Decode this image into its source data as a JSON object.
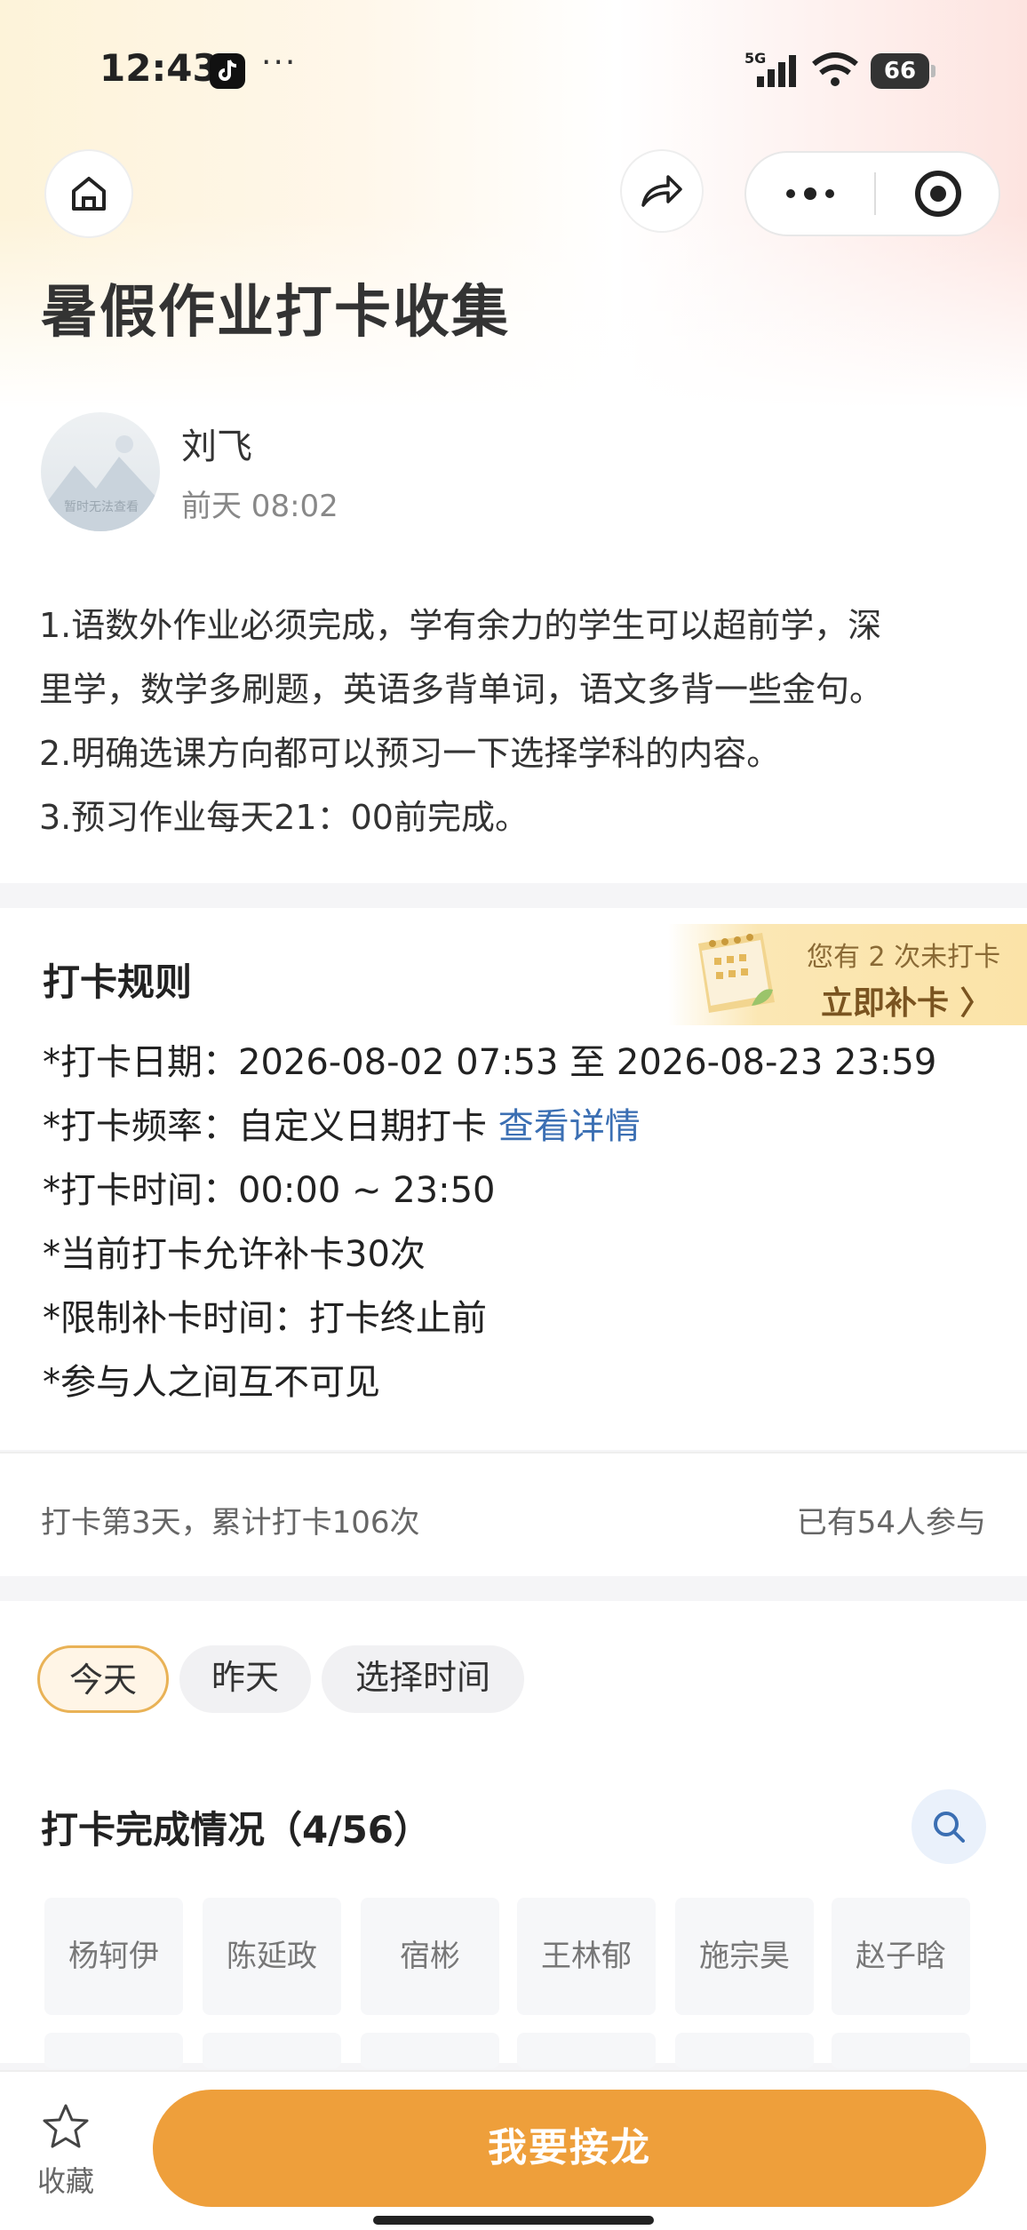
{
  "status_bar": {
    "time": "12:43",
    "more": "···",
    "network": "5G",
    "battery": "66"
  },
  "nav": {
    "home_icon": "home-icon",
    "share_icon": "share-icon",
    "more_icon": "more-dots-icon",
    "close_icon": "target-close-icon"
  },
  "page": {
    "title": "暑假作业打卡收集"
  },
  "post": {
    "author": "刘飞",
    "time": "前天 08:02",
    "avatar_caption": "暂时无法查看",
    "lines": [
      "1.语数外作业必须完成，学有余力的学生可以超前学，深",
      "里学，数学多刷题，英语多背单词，语文多背一些金句。",
      "2.明确选课方向都可以预习一下选择学科的内容。",
      "3.预习作业每天21：00前完成。"
    ]
  },
  "rules": {
    "title": "打卡规则",
    "banner_notice": "您有 2 次未打卡",
    "banner_cta": "立即补卡 〉",
    "date_range": "*打卡日期：2026-08-02 07:53 至 2026-08-23 23:59",
    "frequency_prefix": "*打卡频率：自定义日期打卡 ",
    "frequency_link": "查看详情",
    "time_window": "*打卡时间：00:00 ~ 23:50",
    "makeup_allowed": "*当前打卡允许补卡30次",
    "makeup_limit": "*限制补卡时间：打卡终止前",
    "visibility": "*参与人之间互不可见"
  },
  "stats": {
    "left": "打卡第3天，累计打卡106次",
    "right": "已有54人参与"
  },
  "checkin": {
    "tabs": [
      "今天",
      "昨天",
      "选择时间"
    ],
    "active_tab": "今天",
    "title": "打卡完成情况（4/56）",
    "names": [
      "杨轲伊",
      "陈延政",
      "宿彬",
      "王林郁",
      "施宗昊",
      "赵子晗"
    ]
  },
  "bottom": {
    "favorite_label": "收藏",
    "join_label": "我要接龙"
  },
  "colors": {
    "accent": "#ee9f3b",
    "link": "#3b6fb3",
    "tab_active_border": "#e9b256"
  }
}
